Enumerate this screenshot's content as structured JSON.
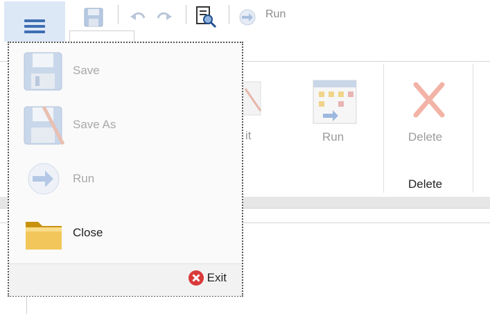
{
  "quick_access": {
    "run_label": "Run",
    "icons": [
      "save-icon",
      "undo-icon",
      "redo-icon",
      "preview-icon",
      "run-icon"
    ]
  },
  "ribbon": {
    "edit_partial_label": "it",
    "run_label": "Run",
    "delete_label": "Delete",
    "delete_group_label": "Delete"
  },
  "app_menu": {
    "items": [
      {
        "label": "Save",
        "icon": "save-icon",
        "enabled": false
      },
      {
        "label": "Save As",
        "icon": "save-as-icon",
        "enabled": false
      },
      {
        "label": "Run",
        "icon": "run-icon",
        "enabled": false
      },
      {
        "label": "Close",
        "icon": "folder-icon",
        "enabled": true
      }
    ],
    "exit_label": "Exit"
  },
  "colors": {
    "app_button_bg": "#dde8f6",
    "hamburger": "#3e6fb3",
    "disabled_text": "#a8a8a8",
    "exit_red": "#d93a3a"
  }
}
